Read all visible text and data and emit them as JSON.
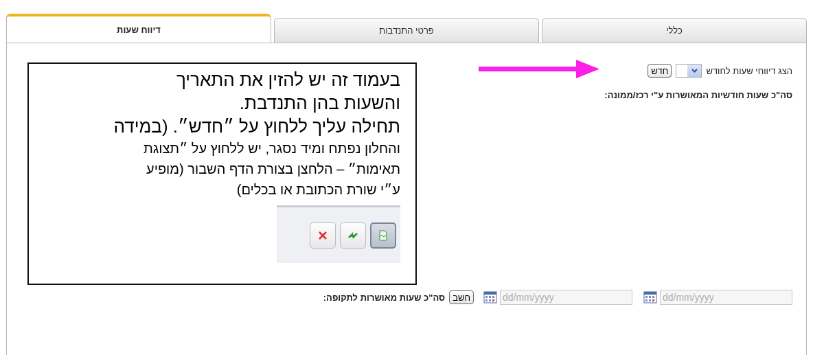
{
  "tabs": [
    {
      "label": "כללי",
      "selected": false
    },
    {
      "label": "פרטי התנדבות",
      "selected": false
    },
    {
      "label": "דיווח שעות",
      "selected": true
    }
  ],
  "month_report": {
    "label": "הצג דיווחי שעות לחודש",
    "button": "חדש"
  },
  "monthly_total": {
    "label": "סה\"כ שעות חודשיות המאושרות ע\"י רכז/ממונה:"
  },
  "period": {
    "from": {
      "placeholder": "dd/mm/yyyy"
    },
    "to": {
      "placeholder": "dd/mm/yyyy"
    },
    "button": "חשב",
    "label": "סה\"כ שעות מאושרות לתקופה:"
  },
  "callout": {
    "lines": [
      {
        "kind": "large",
        "text": "בעמוד זה יש  להזין את התאריך"
      },
      {
        "kind": "large",
        "text": "והשעות בהן התנדבת."
      },
      {
        "kind": "large",
        "text": "תחילה עליך ללחוץ על ״חדש״. (במידה"
      },
      {
        "kind": "small",
        "text": "והחלון נפתח ומיד נסגר, יש ללחוץ על ״תצוגת"
      },
      {
        "kind": "small",
        "text": "תאימות״ –  הלחצן בצורת הדף השבור (מופיע"
      },
      {
        "kind": "small",
        "text": "ע״י שורת הכתובת או בכלים)"
      }
    ],
    "toolbar": [
      {
        "kind": "close",
        "selected": false
      },
      {
        "kind": "refresh",
        "selected": false
      },
      {
        "kind": "compat",
        "selected": true
      }
    ]
  }
}
